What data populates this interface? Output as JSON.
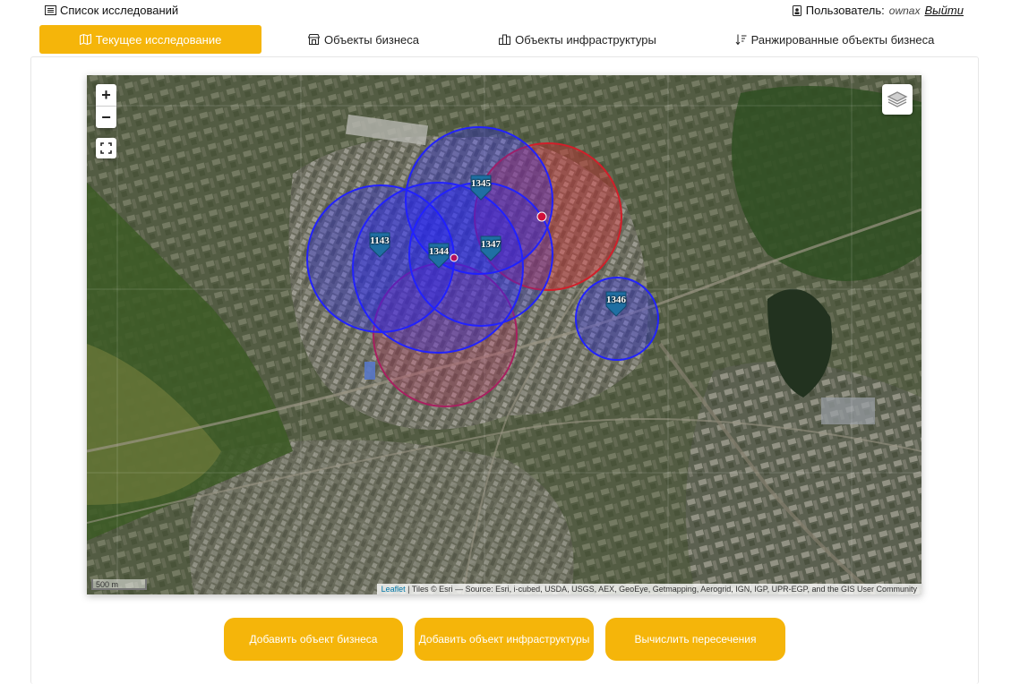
{
  "header": {
    "studies_link": "Список исследований",
    "user_label": "Пользователь:",
    "user_name": "ownax",
    "logout": "Выйти"
  },
  "tabs": [
    {
      "label": "Текущее исследование",
      "icon": "map-icon",
      "active": true
    },
    {
      "label": "Объекты бизнеса",
      "icon": "shop-icon",
      "active": false
    },
    {
      "label": "Объекты инфраструктуры",
      "icon": "buildings-icon",
      "active": false
    },
    {
      "label": "Ранжированные объекты бизнеса",
      "icon": "sort-icon",
      "active": false
    }
  ],
  "map": {
    "zoom_in": "+",
    "zoom_out": "−",
    "scale": "500 m",
    "attribution_link": "Leaflet",
    "attribution_text": "| Tiles © Esri — Source: Esri, i-cubed, USDA, USGS, AEX, GeoEye, Getmapping, Aerogrid, IGN, IGP, UPR-EGP, and the GIS User Community",
    "markers": [
      {
        "label": "1345"
      },
      {
        "label": "1143"
      },
      {
        "label": "1344"
      },
      {
        "label": "1347"
      },
      {
        "label": "1346"
      }
    ],
    "circle_colors": {
      "infrastructure": "#e0282f",
      "business": "#2222ff"
    },
    "marker_color": "#1f6fa3"
  },
  "buttons": {
    "add_business": "Добавить объект бизнеса",
    "add_infrastructure": "Добавить объект инфраструктуры",
    "calc_intersections": "Вычислить пересечения"
  }
}
